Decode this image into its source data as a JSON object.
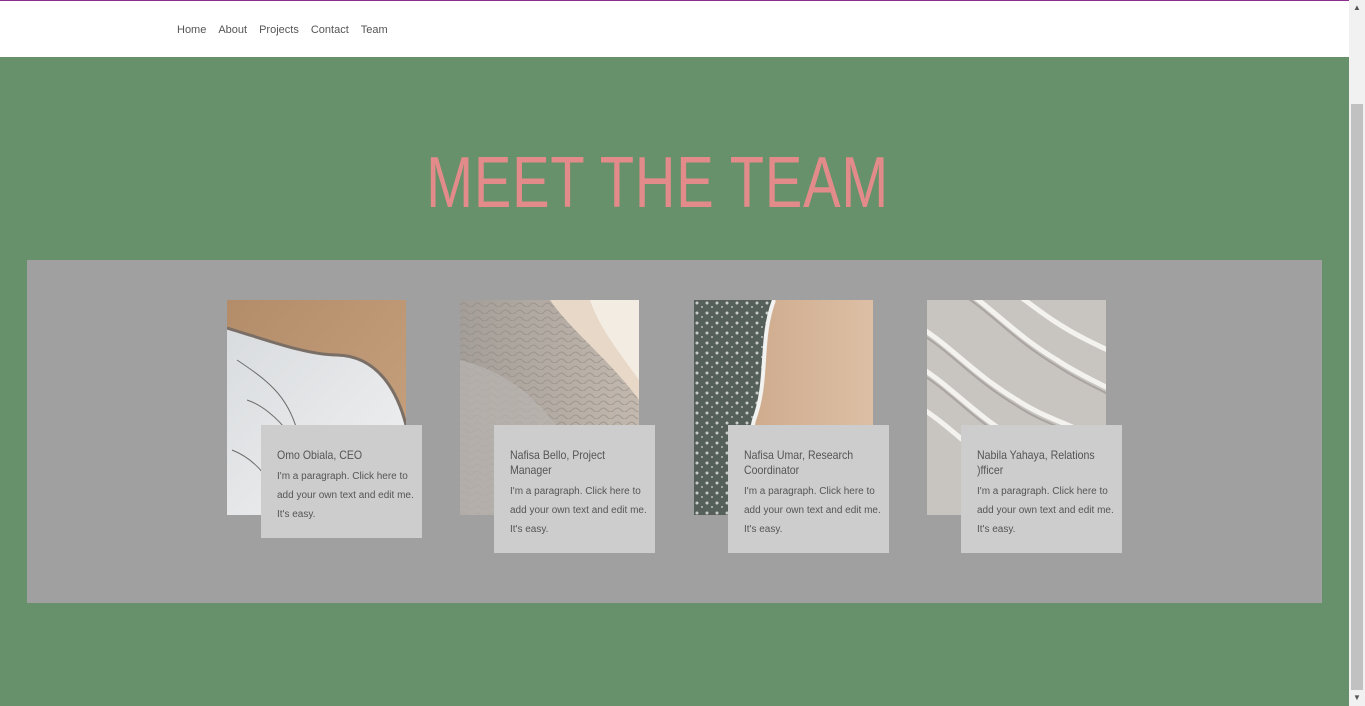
{
  "nav": {
    "items": [
      {
        "label": "Home"
      },
      {
        "label": "About"
      },
      {
        "label": "Projects"
      },
      {
        "label": "Contact"
      },
      {
        "label": "Team"
      }
    ]
  },
  "hero": {
    "title": "MEET THE TEAM"
  },
  "team": {
    "members": [
      {
        "name": "Omo Obiala, CEO",
        "bio": "I'm a paragraph. Click here to add your own text and edit me. It's easy.",
        "photo": "aerial-shore-photo"
      },
      {
        "name": "Nafisa Bello, Project Manager",
        "bio": "I'm a paragraph. Click here to add your own text and edit me. It's easy.",
        "photo": "sand-ripples-photo"
      },
      {
        "name": "Nafisa Umar, Research Coordinator",
        "bio": "I'm a paragraph. Click here to add your own text and edit me. It's easy.",
        "photo": "aerial-beach-photo"
      },
      {
        "name": "Nabila Yahaya, Relations )fficer",
        "bio": "I'm a paragraph. Click here to add your own text and edit me. It's easy.",
        "photo": "sand-dunes-photo"
      }
    ]
  },
  "colors": {
    "background": "#67916a",
    "title": "#e38b8b",
    "panel": "#a0a0a0",
    "card": "#cdcdcd",
    "topline": "#8c2e8c"
  }
}
